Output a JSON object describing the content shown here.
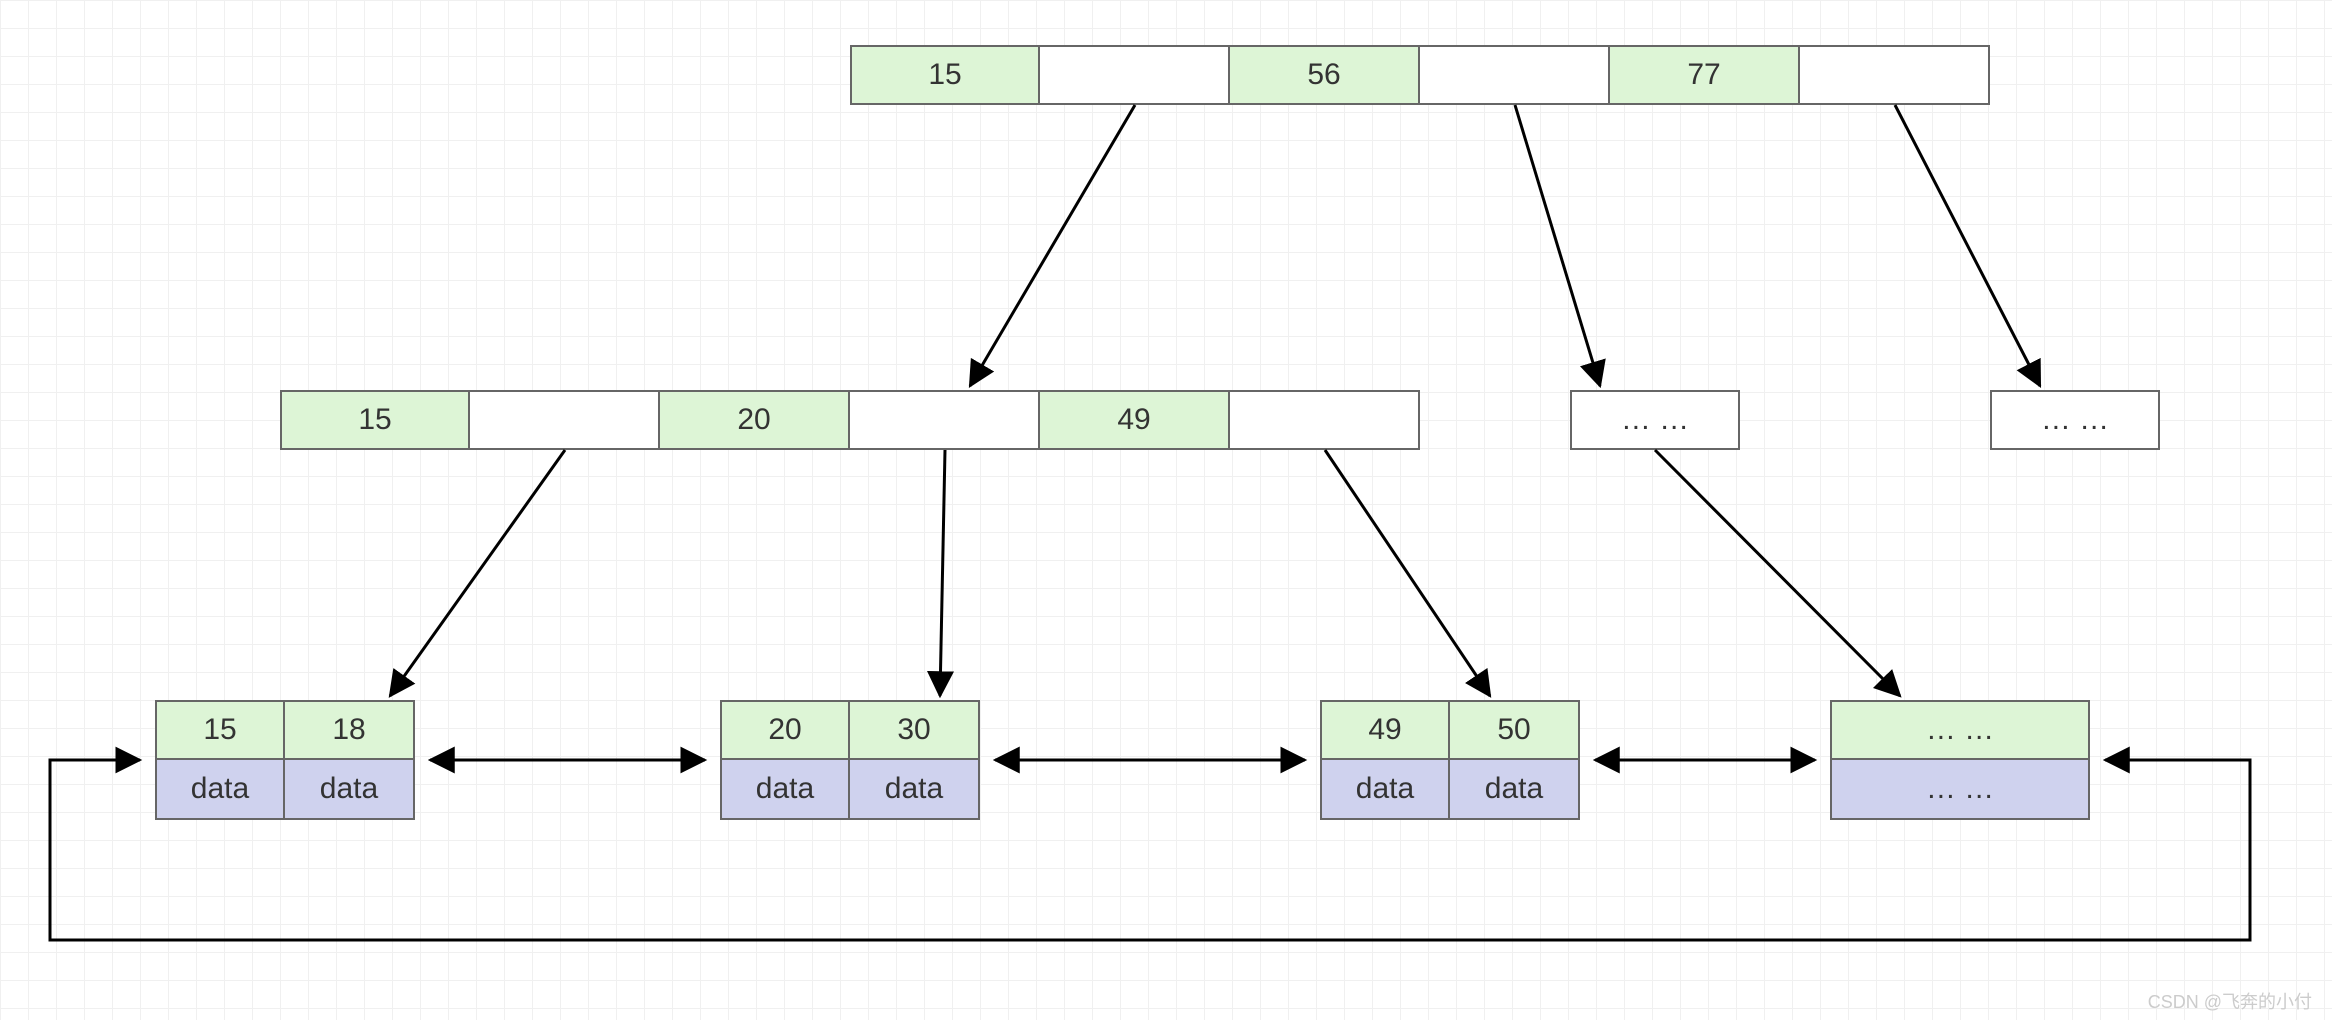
{
  "root": {
    "keys": [
      "15",
      "56",
      "77"
    ]
  },
  "internal": {
    "keys": [
      "15",
      "20",
      "49"
    ]
  },
  "ellipsis": "… …",
  "leaves": [
    {
      "keys": [
        "15",
        "18"
      ],
      "data": [
        "data",
        "data"
      ]
    },
    {
      "keys": [
        "20",
        "30"
      ],
      "data": [
        "data",
        "data"
      ]
    },
    {
      "keys": [
        "49",
        "50"
      ],
      "data": [
        "data",
        "data"
      ]
    }
  ],
  "leafEllipsis": {
    "keys": "… …",
    "data": "… …"
  },
  "watermark": "CSDN @飞奔的小付"
}
